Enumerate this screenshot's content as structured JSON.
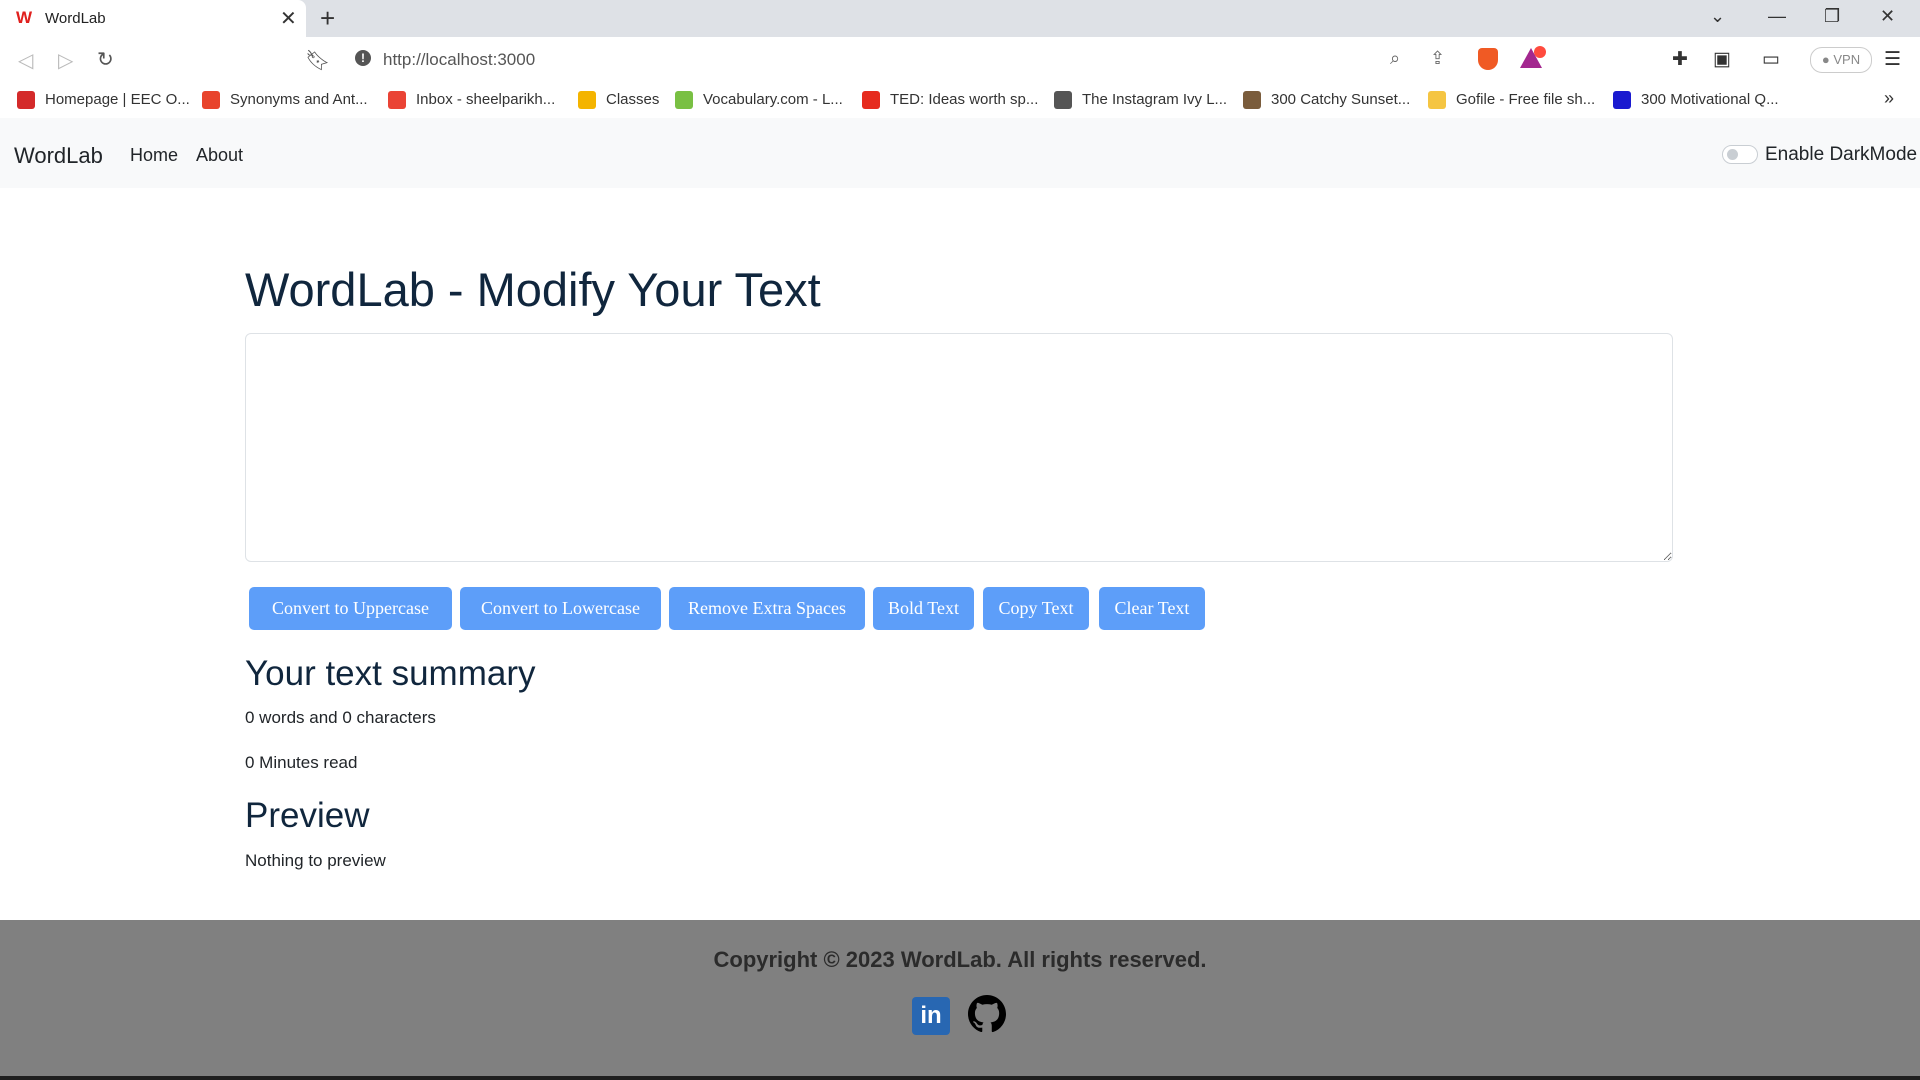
{
  "browser": {
    "tab_title": "WordLab",
    "url": "http://localhost:3000",
    "vpn_label": "VPN",
    "bookmarks": [
      {
        "label": "Homepage | EEC O...",
        "color": "#d42a2a"
      },
      {
        "label": "Synonyms and Ant...",
        "color": "#e8442c"
      },
      {
        "label": "Inbox - sheelparikh...",
        "color": "#ea4335"
      },
      {
        "label": "Classes",
        "color": "#f4b400"
      },
      {
        "label": "Vocabulary.com - L...",
        "color": "#79c043"
      },
      {
        "label": "TED: Ideas worth sp...",
        "color": "#e62b1e"
      },
      {
        "label": "The Instagram Ivy L...",
        "color": "#555555"
      },
      {
        "label": "300 Catchy Sunset...",
        "color": "#7a5c3c"
      },
      {
        "label": "Gofile - Free file sh...",
        "color": "#f5c542"
      },
      {
        "label": "300 Motivational Q...",
        "color": "#1a1ad0"
      }
    ]
  },
  "navbar": {
    "brand": "WordLab",
    "links": [
      "Home",
      "About"
    ],
    "darkmode_label": "Enable DarkMode",
    "darkmode_enabled": false
  },
  "main": {
    "heading": "WordLab - Modify Your Text",
    "textarea_value": "",
    "buttons": [
      "Convert to Uppercase",
      "Convert to Lowercase",
      "Remove Extra Spaces",
      "Bold Text",
      "Copy Text",
      "Clear Text"
    ],
    "summary_heading": "Your text summary",
    "summary_counts": "0 words and 0 characters",
    "summary_read": "0 Minutes read",
    "preview_heading": "Preview",
    "preview_text": "Nothing to preview"
  },
  "footer": {
    "copyright": "Copyright © 2023 WordLab. All rights reserved.",
    "linkedin_label": "in"
  },
  "colors": {
    "accent_button": "#5d9ef9",
    "heading": "#10263d",
    "footer_bg": "#808080"
  }
}
